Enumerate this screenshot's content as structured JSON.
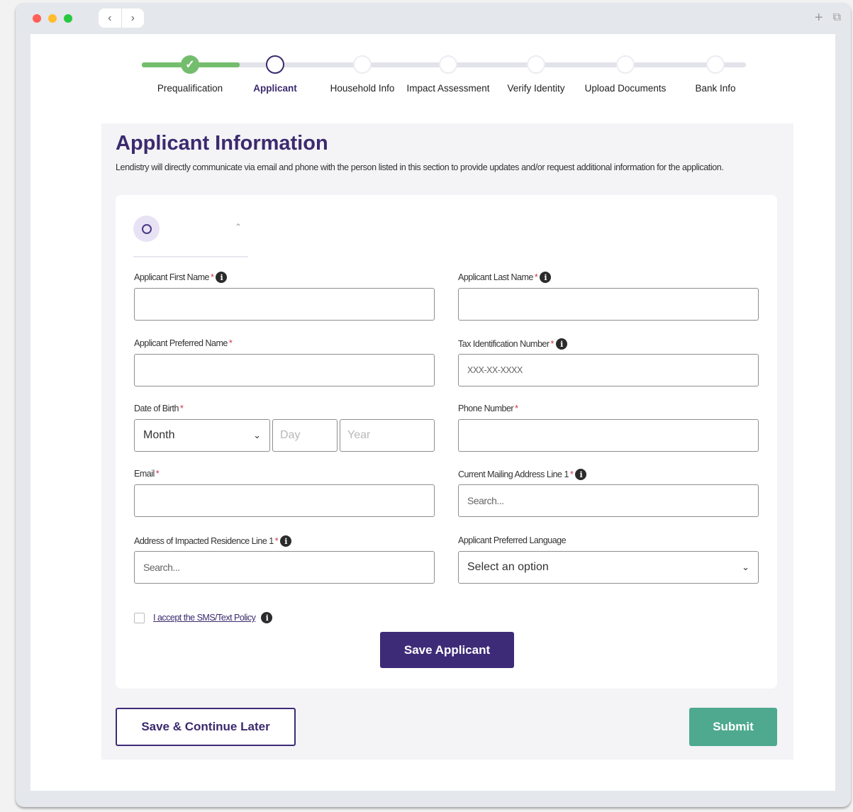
{
  "window": {
    "nav_back": "‹",
    "nav_forward": "›",
    "new_tab": "+",
    "tabs_overview": "⧉"
  },
  "stepper": {
    "steps": [
      {
        "label": "Prequalification",
        "state": "complete"
      },
      {
        "label": "Applicant",
        "state": "current"
      },
      {
        "label": "Household Info",
        "state": "pending"
      },
      {
        "label": "Impact Assessment",
        "state": "pending"
      },
      {
        "label": "Verify Identity",
        "state": "pending"
      },
      {
        "label": "Upload Documents",
        "state": "pending"
      },
      {
        "label": "Bank Info",
        "state": "pending"
      }
    ],
    "check_glyph": "✓"
  },
  "section": {
    "title": "Applicant Information",
    "description": "Lendistry will directly communicate via email and phone with the person listed in this section to provide updates and/or request additional information for the application."
  },
  "card": {
    "tab_chevron": "⌃",
    "required_marker": "*",
    "info_glyph": "i",
    "fields": {
      "first_name": {
        "label": "Applicant First Name",
        "value": ""
      },
      "last_name": {
        "label": "Applicant Last Name",
        "value": ""
      },
      "preferred_name": {
        "label": "Applicant Preferred Name",
        "value": ""
      },
      "tax_id": {
        "label": "Tax Identification Number",
        "placeholder": "XXX-XX-XXXX"
      },
      "dob": {
        "label": "Date of Birth",
        "month": "Month",
        "day_placeholder": "Day",
        "year_placeholder": "Year"
      },
      "phone": {
        "label": "Phone Number",
        "value": ""
      },
      "email": {
        "label": "Email",
        "value": ""
      },
      "mailing_address": {
        "label": "Current Mailing Address Line 1",
        "placeholder": "Search..."
      },
      "impacted_address": {
        "label": "Address of Impacted Residence Line 1",
        "placeholder": "Search..."
      },
      "language": {
        "label": "Applicant Preferred Language",
        "value": "Select an option"
      }
    },
    "sms_policy": "I accept the SMS/Text Policy",
    "save_button": "Save Applicant"
  },
  "actions": {
    "save_later": "Save & Continue Later",
    "submit": "Submit"
  },
  "colors": {
    "brand_purple": "#3e2b78",
    "step_complete": "#74bd6e",
    "submit_green": "#4ea98e",
    "required_red": "#d0324a"
  }
}
